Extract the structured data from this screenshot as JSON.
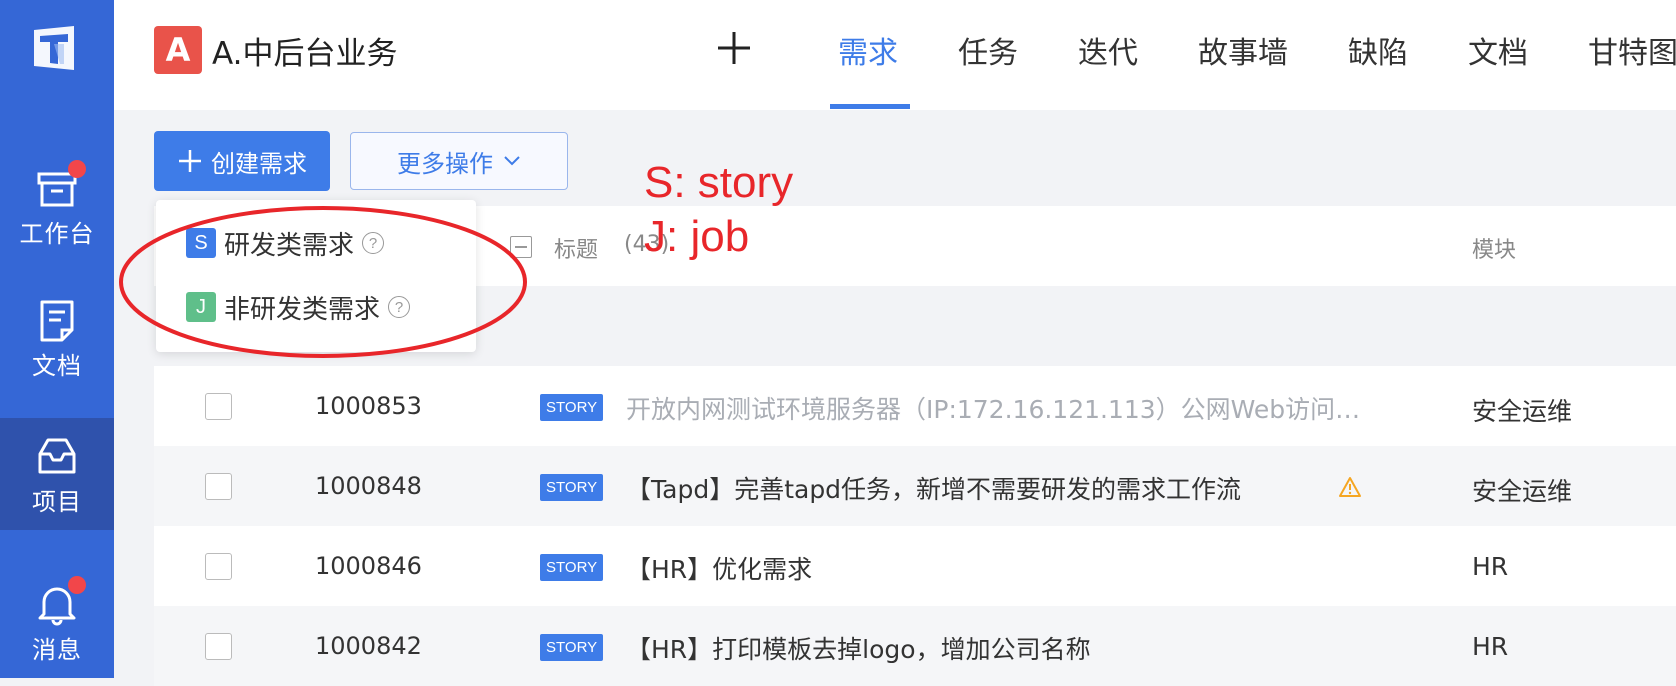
{
  "sidebar": {
    "items": [
      {
        "label": "工作台",
        "icon": "archive-icon",
        "badge": true
      },
      {
        "label": "文档",
        "icon": "document-icon",
        "badge": false
      },
      {
        "label": "项目",
        "icon": "inbox-icon",
        "badge": false,
        "active": true
      },
      {
        "label": "消息",
        "icon": "bell-icon",
        "badge": true
      }
    ]
  },
  "header": {
    "project_badge": "A",
    "project_name": "A.中后台业务",
    "tabs": [
      {
        "label": "需求",
        "active": true
      },
      {
        "label": "任务"
      },
      {
        "label": "迭代"
      },
      {
        "label": "故事墙"
      },
      {
        "label": "缺陷"
      },
      {
        "label": "文档"
      },
      {
        "label": "甘特图"
      }
    ]
  },
  "toolbar": {
    "create_label": "创建需求",
    "more_label": "更多操作"
  },
  "dropdown": {
    "items": [
      {
        "badge": "S",
        "label": "研发类需求",
        "color": "#3e7ce8"
      },
      {
        "badge": "J",
        "label": "非研发类需求",
        "color": "#5fbf8a"
      }
    ]
  },
  "table": {
    "headers": {
      "title": "标题",
      "count": "(43)",
      "module": "模块"
    },
    "rows": [
      {
        "id": "1000853",
        "tag": "STORY",
        "title": "开放内网测试环境服务器（IP:172.16.121.113）公网Web访问…",
        "module": "安全运维",
        "muted": true,
        "warning": false
      },
      {
        "id": "1000848",
        "tag": "STORY",
        "title": "【Tapd】完善tapd任务，新增不需要研发的需求工作流",
        "module": "安全运维",
        "muted": false,
        "warning": true
      },
      {
        "id": "1000846",
        "tag": "STORY",
        "title": "【HR】优化需求",
        "module": "HR",
        "muted": false,
        "warning": false
      },
      {
        "id": "1000842",
        "tag": "STORY",
        "title": "【HR】打印模板去掉logo，增加公司名称",
        "module": "HR",
        "muted": false,
        "warning": false
      }
    ]
  },
  "annotations": {
    "line1": "S: story",
    "line2": "J: job",
    "color": "#e8262a"
  }
}
